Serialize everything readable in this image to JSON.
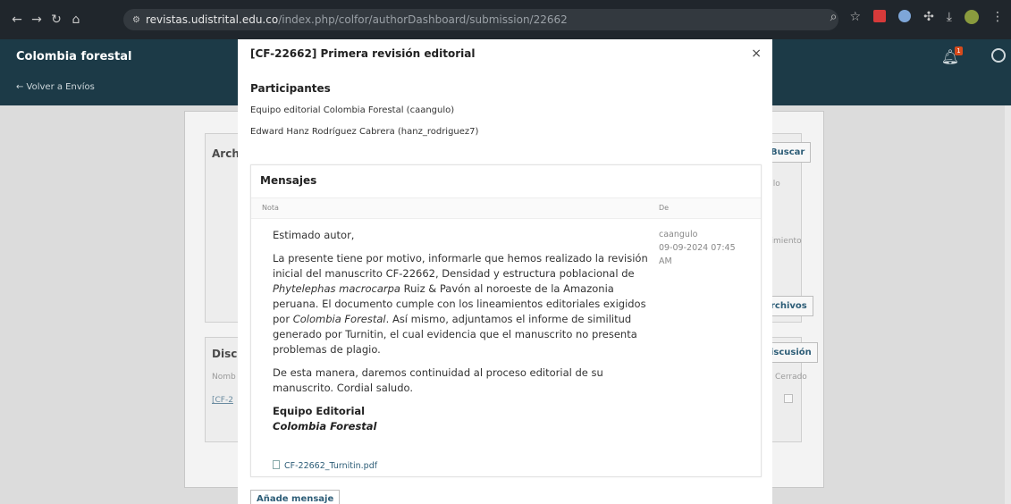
{
  "browser": {
    "url_host": "revistas.udistrital.edu.co",
    "url_path": "/index.php/colfor/authorDashboard/submission/22662"
  },
  "app": {
    "brand": "Colombia forestal",
    "back_link": "← Volver a Envíos",
    "notification_count": "1"
  },
  "background": {
    "section1_title": "Arch",
    "search_button": "Buscar",
    "row1_text": "ulo",
    "row2_text": "timiento",
    "files_button": "rchivos",
    "section2_title": "Discu",
    "discussion_button": "iscusión",
    "col_name": "Nomb",
    "col_closed": "Cerrado",
    "row_link": "[CF-2"
  },
  "modal": {
    "title": "[CF-22662] Primera revisión editorial",
    "close": "×",
    "participants_title": "Participantes",
    "participants": [
      "Equipo editorial Colombia Forestal (caangulo)",
      "Edward Hanz Rodríguez Cabrera (hanz_rodriguez7)"
    ],
    "messages_title": "Mensajes",
    "col_note": "Nota",
    "col_from": "De",
    "message": {
      "greeting": "Estimado autor,",
      "p1a": "La presente tiene por motivo, informarle que hemos realizado la revisión inicial del manuscrito CF-22662, Densidad y estructura poblacional de ",
      "p1_species": "Phytelephas macrocarpa",
      "p1b": " Ruiz & Pavón al noroeste de la Amazonia peruana. El documento cumple con los lineamientos editoriales exigidos por ",
      "p1_journal": "Colombia Forestal",
      "p1c": ". Así mismo, adjuntamos el informe de similitud generado por Turnitin, el cual evidencia que el manuscrito no presenta problemas de plagio.",
      "p2": "De esta manera, daremos continuidad al proceso editorial de su manuscrito. Cordial saludo.",
      "sig1": "Equipo Editorial",
      "sig2": "Colombia Forestal",
      "from_user": "caangulo",
      "from_date": "09-09-2024 07:45",
      "from_time_suffix": "AM",
      "attachment": "CF-22662_Turnitin.pdf"
    },
    "add_message": "Añade mensaje"
  }
}
